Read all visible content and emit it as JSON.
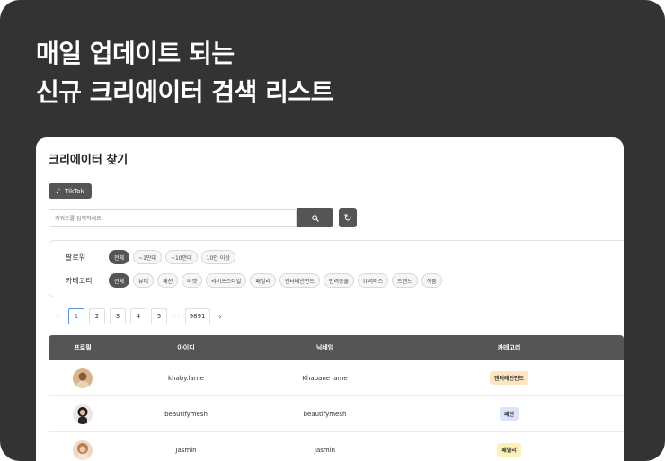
{
  "headline": {
    "line1": "매일 업데이트 되는",
    "line2": "신규 크리에이터 검색 리스트"
  },
  "panel": {
    "title": "크리에이터 찾기",
    "platform_tag": "TikTok",
    "platform_icon": "tiktok-icon",
    "search": {
      "placeholder": "키워드를 입력하세요",
      "value": ""
    },
    "filters": {
      "followers": {
        "label": "팔로워",
        "options": [
          "전체",
          "~1만대",
          "~10만대",
          "10만 이상"
        ],
        "selected": "전체"
      },
      "category": {
        "label": "카테고리",
        "options": [
          "전체",
          "뷰티",
          "패션",
          "마켓",
          "라이프스타일",
          "패밀리",
          "엔터테인먼트",
          "반려동물",
          "IT서비스",
          "트렌드",
          "식품"
        ],
        "selected": "전체"
      }
    },
    "pagination": {
      "pages": [
        "1",
        "2",
        "3",
        "4",
        "5"
      ],
      "current": "1",
      "ellipsis": "···",
      "last": "9891"
    },
    "table": {
      "headers": [
        "프로필",
        "아이디",
        "닉네임",
        "카테고리"
      ],
      "rows": [
        {
          "id": "khaby.lame",
          "nickname": "Khabane lame",
          "category": "엔터테인먼트",
          "badge_color": "#fde6c0"
        },
        {
          "id": "beautifymesh",
          "nickname": "beautifymesh",
          "category": "패션",
          "badge_color": "#dde3fb"
        },
        {
          "id": "Jasmin",
          "nickname": "Jasmin",
          "category": "패밀리",
          "badge_color": "#fdf1b8"
        }
      ]
    }
  },
  "colors": {
    "background": "#333333",
    "accent_dark": "#555555",
    "active_page": "#3a6fd8"
  }
}
